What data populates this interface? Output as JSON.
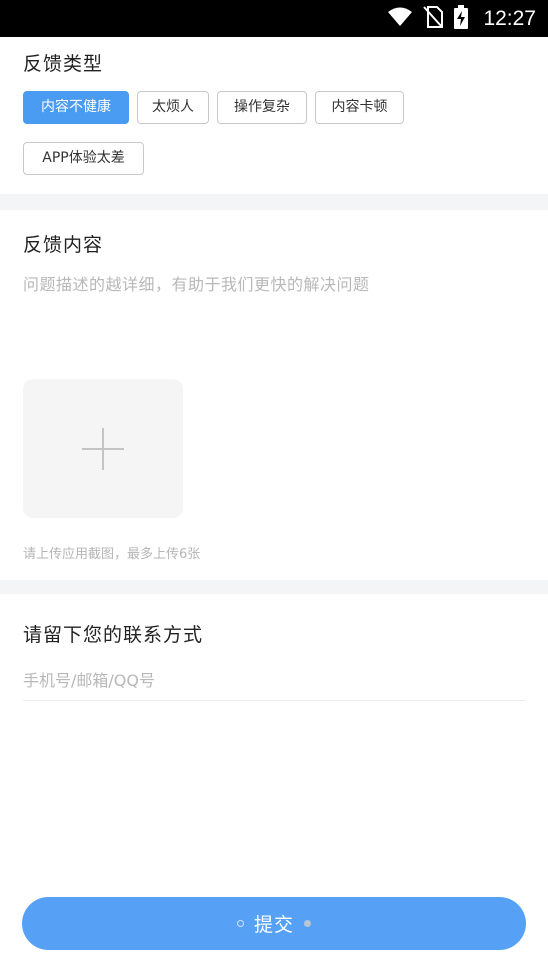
{
  "status_bar": {
    "time": "12:27",
    "icons": [
      "wifi-icon",
      "no-sim-icon",
      "battery-charging-icon"
    ]
  },
  "feedback_type": {
    "title": "反馈类型",
    "tags": [
      {
        "label": "内容不健康",
        "selected": true
      },
      {
        "label": "太烦人",
        "selected": false
      },
      {
        "label": "操作复杂",
        "selected": false
      },
      {
        "label": "内容卡顿",
        "selected": false
      },
      {
        "label": "APP体验太差",
        "selected": false
      }
    ]
  },
  "feedback_content": {
    "title": "反馈内容",
    "placeholder": "问题描述的越详细，有助于我们更快的解决问题",
    "upload_icon": "plus-icon",
    "upload_hint": "请上传应用截图，最多上传6张"
  },
  "contact": {
    "title": "请留下您的联系方式",
    "placeholder": "手机号/邮箱/QQ号"
  },
  "submit": {
    "label": "提交"
  },
  "colors": {
    "accent": "#4a9bf2",
    "button": "#56a1f5",
    "divider": "#f4f5f7"
  }
}
